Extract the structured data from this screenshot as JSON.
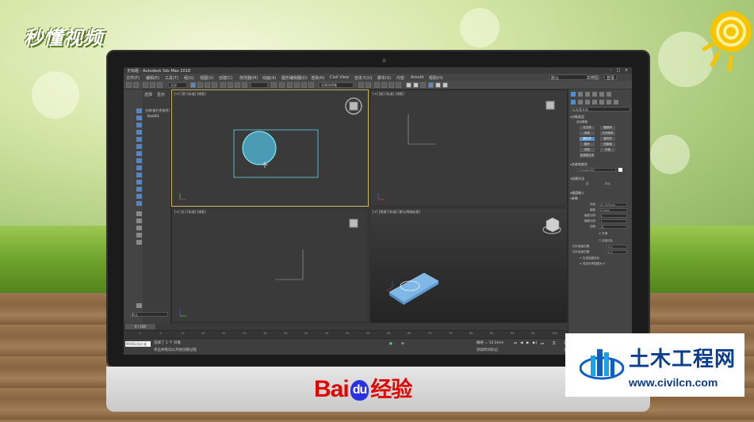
{
  "watermarks": {
    "brand": "秒懂视频",
    "baidu_bai": "Bai",
    "baidu_du": "du",
    "baidu_jingyan": "经验",
    "civil_cn": "土木工程网",
    "civil_url": "www.civilcn.com"
  },
  "app": {
    "title": "无标题 - Autodesk 3ds Max 2018",
    "window_buttons": [
      "–",
      "□",
      "×"
    ],
    "menu": [
      "文件(F)",
      "编辑(E)",
      "工具(T)",
      "组(G)",
      "视图(V)",
      "创建(C)",
      "修改器(M)",
      "动画(A)",
      "图形编辑器(D)",
      "渲染(R)",
      "Civil View",
      "自定义(U)",
      "脚本(S)",
      "内容",
      "Arnold",
      "帮助(H)"
    ],
    "workspace": {
      "label": "工作区:",
      "value": "默认",
      "user": "登录"
    },
    "toolbar": {
      "filter": "全部",
      "selection_set": "创建选择集"
    }
  },
  "scene_explorer": {
    "tabs": [
      "选择",
      "显示"
    ],
    "rows": [
      {
        "label": "名称(按升序排序)"
      },
      {
        "label": "Box001"
      }
    ],
    "layer_dropdown": "默认"
  },
  "viewports": [
    {
      "label": "[+] [顶] [标准] [线框]"
    },
    {
      "label": "[+] [前] [标准] [线框]"
    },
    {
      "label": "[+] [左] [标准] [线框]"
    },
    {
      "label": "[+] [透视] [标准] [默认明暗处理]"
    }
  ],
  "timeline": {
    "slider": "0 / 100",
    "ticks": [
      "0",
      "5",
      "10",
      "15",
      "20",
      "25",
      "30",
      "35",
      "40",
      "45",
      "50",
      "55",
      "60",
      "65",
      "70",
      "75",
      "80",
      "85",
      "90",
      "95",
      "100"
    ]
  },
  "status": {
    "maxscript": "MAXScript 迷",
    "selected": "选择了 1 个 对象",
    "prompt": "单击并拖动以开始创建过程",
    "grid": "栅格 = 10.0mm",
    "add_time_tag": "添加时间标记",
    "autokey": "自动关键点",
    "set_key": "设置关键点",
    "filters": "关键点过滤器..."
  },
  "command_panel": {
    "category": "标准基本体",
    "object_type": "对象类型",
    "autogrid": "自动栅格",
    "buttons": [
      "长方体",
      "圆锥体",
      "球体",
      "几何球体",
      "圆柱体",
      "管状体",
      "圆环",
      "四棱锥",
      "茶壶",
      "平面",
      "加强型文本"
    ],
    "selected_button": "圆柱体",
    "name_color": "名称和颜色",
    "object_name": "Cylinder001",
    "creation_method": "创建方法",
    "methods": [
      "边",
      "中心"
    ],
    "keyboard_entry": "键盘输入",
    "parameters": "参数",
    "params": [
      {
        "label": "半径:",
        "value": "20.325mm"
      },
      {
        "label": "高度:",
        "value": "0.0mm"
      },
      {
        "label": "高度分段:",
        "value": "5"
      },
      {
        "label": "端面分段:",
        "value": "1"
      },
      {
        "label": "边数:",
        "value": "18"
      }
    ],
    "smooth": "平滑",
    "slice_on": "启用切片",
    "slice_from": "切片起始位置:",
    "slice_to": "切片结束位置:",
    "slice_from_value": "0.0",
    "slice_to_value": "0.0",
    "gen_uv": "生成贴图坐标",
    "real_world": "真实世界贴图大小"
  },
  "colors": {
    "accent": "#4f8fcf",
    "active_viewport": "#c8b25a",
    "selection": "#5ad6e6"
  }
}
